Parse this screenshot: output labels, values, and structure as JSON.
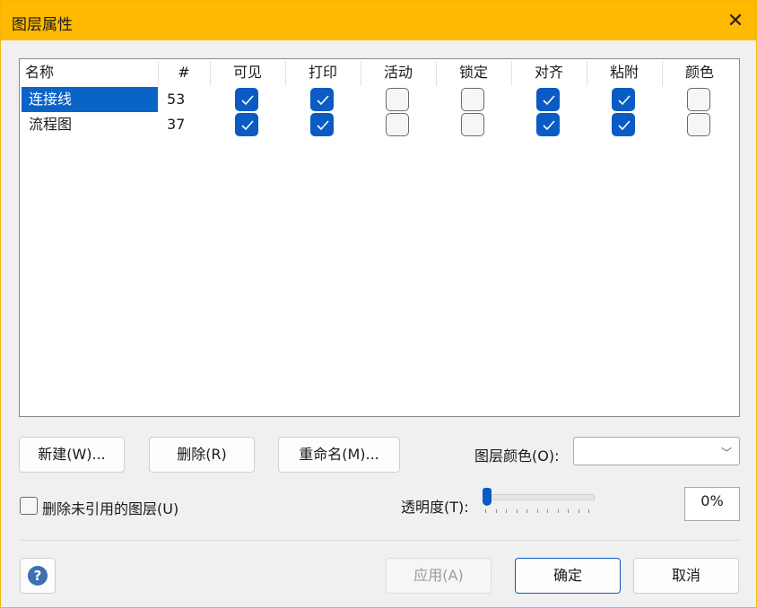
{
  "window": {
    "title": "图层属性",
    "close_icon": "close-icon"
  },
  "table": {
    "columns": [
      "名称",
      "#",
      "可见",
      "打印",
      "活动",
      "锁定",
      "对齐",
      "粘附",
      "颜色"
    ],
    "rows": [
      {
        "name": "连接线",
        "count": "53",
        "selected": true,
        "flags": [
          true,
          true,
          false,
          false,
          true,
          true,
          false
        ]
      },
      {
        "name": "流程图",
        "count": "37",
        "selected": false,
        "flags": [
          true,
          true,
          false,
          false,
          true,
          true,
          false
        ]
      }
    ]
  },
  "buttons": {
    "new": "新建(W)...",
    "delete": "删除(R)",
    "rename": "重命名(M)..."
  },
  "layer_color": {
    "label": "图层颜色(O):",
    "value": ""
  },
  "remove_unused": {
    "label": "删除未引用的图层(U)",
    "checked": false
  },
  "transparency": {
    "label": "透明度(T):",
    "value_text": "0%",
    "value": 0
  },
  "footer": {
    "help_icon": "help-icon",
    "apply": "应用(A)",
    "ok": "确定",
    "cancel": "取消"
  },
  "colors": {
    "title_bar": "#ffb900",
    "accent": "#0a5bc4",
    "selection": "#0a64c8"
  }
}
